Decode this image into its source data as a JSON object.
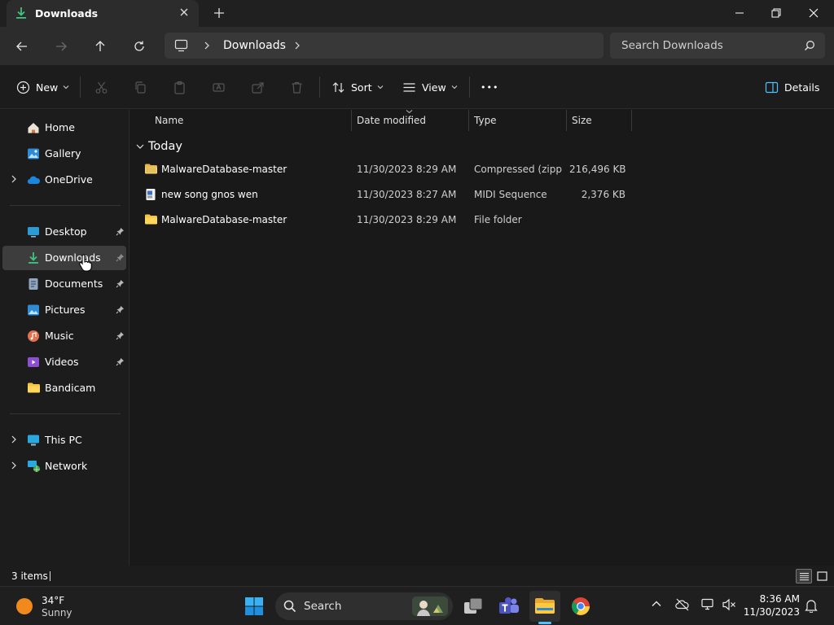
{
  "window": {
    "tab_title": "Downloads",
    "new_tab_symbol": "+"
  },
  "nav": {
    "breadcrumb": [
      "Downloads"
    ],
    "search_placeholder": "Search Downloads"
  },
  "command_bar": {
    "new_label": "New",
    "sort_label": "Sort",
    "view_label": "View",
    "more_label": "•••",
    "details_label": "Details"
  },
  "sidebar": {
    "quick": [
      {
        "label": "Home",
        "icon": "home-icon"
      },
      {
        "label": "Gallery",
        "icon": "gallery-icon"
      },
      {
        "label": "OneDrive",
        "icon": "onedrive-icon",
        "expandable": true
      }
    ],
    "pinned": [
      {
        "label": "Desktop",
        "icon": "desktop-icon",
        "pinned": true
      },
      {
        "label": "Downloads",
        "icon": "downloads-icon",
        "pinned": true,
        "selected": true
      },
      {
        "label": "Documents",
        "icon": "documents-icon",
        "pinned": true
      },
      {
        "label": "Pictures",
        "icon": "pictures-icon",
        "pinned": true
      },
      {
        "label": "Music",
        "icon": "music-icon",
        "pinned": true
      },
      {
        "label": "Videos",
        "icon": "videos-icon",
        "pinned": true
      },
      {
        "label": "Bandicam",
        "icon": "folder-icon",
        "pinned": false
      }
    ],
    "devices": [
      {
        "label": "This PC",
        "icon": "this-pc-icon",
        "expandable": true
      },
      {
        "label": "Network",
        "icon": "network-icon",
        "expandable": true
      }
    ]
  },
  "filelist": {
    "columns": [
      "Name",
      "Date modified",
      "Type",
      "Size"
    ],
    "group_label": "Today",
    "rows": [
      {
        "name": "MalwareDatabase-master",
        "date": "11/30/2023 8:29 AM",
        "type": "Compressed (zipp...",
        "size": "216,496 KB",
        "icon": "zip-folder-icon"
      },
      {
        "name": "new song gnos wen",
        "date": "11/30/2023 8:27 AM",
        "type": "MIDI Sequence",
        "size": "2,376 KB",
        "icon": "midi-file-icon"
      },
      {
        "name": "MalwareDatabase-master",
        "date": "11/30/2023 8:29 AM",
        "type": "File folder",
        "size": "",
        "icon": "folder-icon"
      }
    ]
  },
  "status": {
    "item_count": "3 items"
  },
  "taskbar": {
    "weather_temp": "34°F",
    "weather_cond": "Sunny",
    "search_label": "Search",
    "time": "8:36 AM",
    "date": "11/30/2023"
  },
  "colors": {
    "accent": "#4cc2ff",
    "folder": "#f4c542",
    "selection": "#3d3d3d",
    "sun": "#f08a1c"
  }
}
